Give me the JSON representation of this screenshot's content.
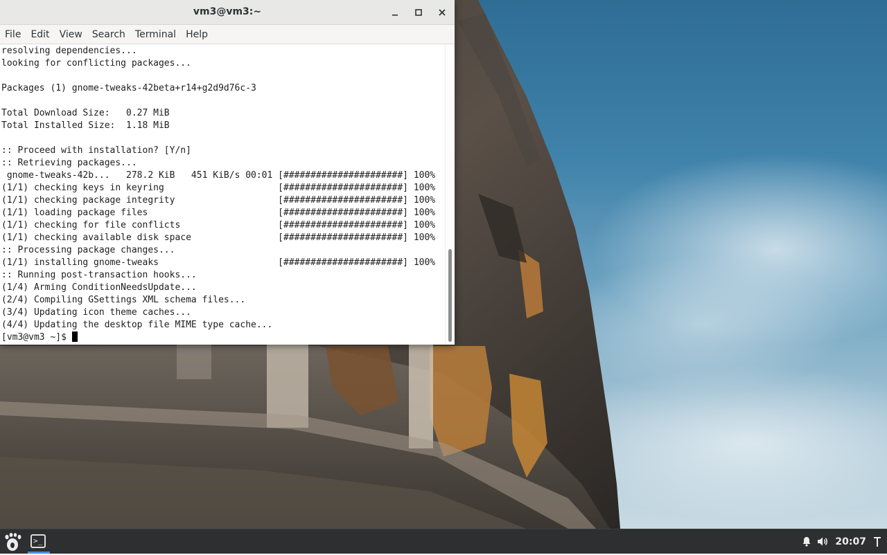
{
  "window": {
    "title": "vm3@vm3:~",
    "controls": {
      "minimize": "minimize-icon",
      "maximize": "maximize-icon",
      "close": "close-icon"
    }
  },
  "menu": {
    "file": "File",
    "edit": "Edit",
    "view": "View",
    "search": "Search",
    "terminal": "Terminal",
    "help": "Help"
  },
  "terminal": {
    "lines": [
      "resolving dependencies...",
      "looking for conflicting packages...",
      "",
      "Packages (1) gnome-tweaks-42beta+r14+g2d9d76c-3",
      "",
      "Total Download Size:   0.27 MiB",
      "Total Installed Size:  1.18 MiB",
      "",
      ":: Proceed with installation? [Y/n]",
      ":: Retrieving packages...",
      " gnome-tweaks-42b...   278.2 KiB   451 KiB/s 00:01 [######################] 100%",
      "(1/1) checking keys in keyring                     [######################] 100%",
      "(1/1) checking package integrity                   [######################] 100%",
      "(1/1) loading package files                        [######################] 100%",
      "(1/1) checking for file conflicts                  [######################] 100%",
      "(1/1) checking available disk space                [######################] 100%",
      ":: Processing package changes...",
      "(1/1) installing gnome-tweaks                      [######################] 100%",
      ":: Running post-transaction hooks...",
      "(1/4) Arming ConditionNeedsUpdate...",
      "(2/4) Compiling GSettings XML schema files...",
      "(3/4) Updating icon theme caches...",
      "(4/4) Updating the desktop file MIME type cache..."
    ],
    "prompt": "[vm3@vm3 ~]$ "
  },
  "panel": {
    "activities_icon": "gnome-foot-icon",
    "task_icon": "terminal-icon",
    "task_glyph": ">_",
    "clock": "20:07",
    "tray": {
      "notifications": "bell-icon",
      "volume": "speaker-icon",
      "power": "power-icon"
    }
  },
  "colors": {
    "panel_bg": "#2d2f31",
    "titlebar_bg": "#e8e8e7",
    "accent": "#4a90d9"
  }
}
